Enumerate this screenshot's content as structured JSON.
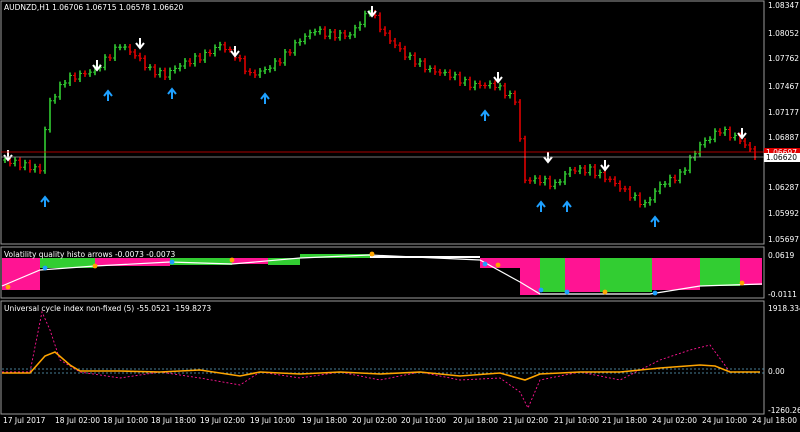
{
  "symbol_header": "AUDNZD,H1  1.06706 1.06715 1.06578 1.06620",
  "price_axis": [
    "1.08347",
    "1.08052",
    "1.07762",
    "1.07467",
    "1.07177",
    "1.06887",
    "1.06287",
    "1.05992",
    "1.05697"
  ],
  "current_price": "1.06620",
  "red_price_tag": "1.06697",
  "indicator1": {
    "title": "Volatility quality histo arrows -0.0073 -0.0073",
    "axis_top": "0.0619",
    "axis_bottom": "-0.0111"
  },
  "indicator2": {
    "title": "Universal cycle index non-fixed (5) -55.0521 -159.8273",
    "axis_top": "1918.3348",
    "axis_mid": "0.00",
    "axis_bottom": "-1260.2686"
  },
  "time_axis": [
    "17 Jul 2017",
    "18 Jul 02:00",
    "18 Jul 10:00",
    "18 Jul 18:00",
    "19 Jul 02:00",
    "19 Jul 10:00",
    "19 Jul 18:00",
    "20 Jul 02:00",
    "20 Jul 10:00",
    "20 Jul 18:00",
    "21 Jul 02:00",
    "21 Jul 10:00",
    "21 Jul 18:00",
    "24 Jul 02:00",
    "24 Jul 10:00",
    "24 Jul 18:00"
  ],
  "colors": {
    "bull": "#32cd32",
    "bear": "#e00000",
    "magenta": "#ff1493",
    "up_arrow": "#1ea0ff",
    "down_arrow": "#ffffff",
    "orange": "#ffa500"
  }
}
